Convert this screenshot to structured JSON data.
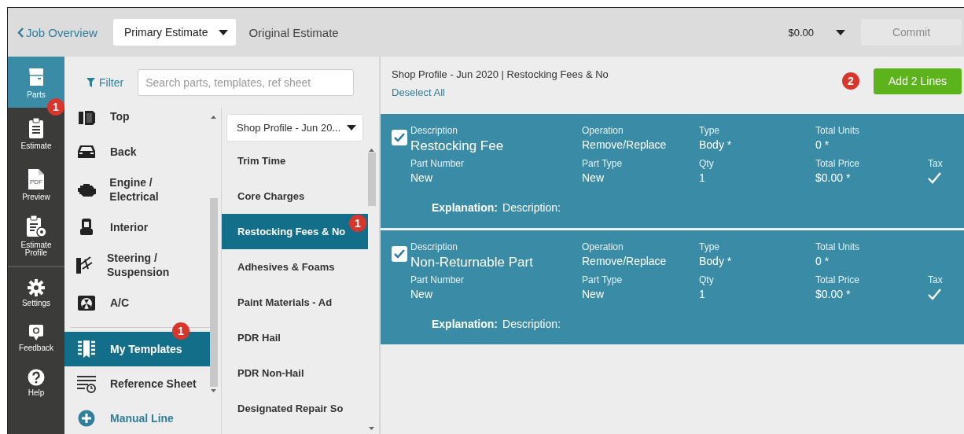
{
  "header": {
    "back_link": "Job Overview",
    "estimate_select": "Primary Estimate",
    "estimate_name": "Original Estimate",
    "total": "$0.00",
    "commit_button": {
      "label": "Commit",
      "disabled": true
    }
  },
  "rail": {
    "main": [
      {
        "label": "Parts",
        "kind": "door",
        "selected": true,
        "badge": "1"
      },
      {
        "label": "Estimate",
        "kind": "clipboard",
        "selected": false
      },
      {
        "label": "Preview",
        "kind": "pdf",
        "icon_text": "PDF",
        "selected": false
      },
      {
        "label": "Estimate Profile",
        "kind": "profile",
        "selected": false
      }
    ],
    "bottom": [
      {
        "label": "Settings",
        "kind": "gear",
        "selected": false
      },
      {
        "label": "Feedback",
        "kind": "chat",
        "selected": false
      },
      {
        "label": "Help",
        "kind": "help",
        "selected": false
      }
    ]
  },
  "browser": {
    "filter": "Filter",
    "search_placeholder": "Search parts, templates, ref sheet",
    "categories": [
      {
        "label": "Top",
        "kind": "top",
        "selected": false
      },
      {
        "label": "Back",
        "kind": "back",
        "selected": false
      },
      {
        "label": "Engine / Electrical",
        "kind": "engine",
        "selected": false
      },
      {
        "label": "Interior",
        "kind": "seat",
        "selected": false
      },
      {
        "label": "Steering / Suspension",
        "kind": "steering",
        "selected": false
      },
      {
        "label": "A/C",
        "kind": "fan",
        "selected": false
      }
    ],
    "library": [
      {
        "label": "My Templates",
        "kind": "templates",
        "selected": true,
        "badge": "1"
      },
      {
        "label": "Reference Sheet",
        "kind": "reference",
        "selected": false
      }
    ],
    "manual_line": "Manual Line",
    "profile_select": "Shop Profile - Jun 20...",
    "templates": [
      {
        "label": "Trim Time",
        "selected": false
      },
      {
        "label": "Core Charges",
        "selected": false
      },
      {
        "label": "Restocking Fees & No",
        "selected": true,
        "badge": "1"
      },
      {
        "label": "Adhesives & Foams",
        "selected": false
      },
      {
        "label": "Paint Materials - Ad",
        "selected": false
      },
      {
        "label": "PDR Hail",
        "selected": false
      },
      {
        "label": "PDR Non-Hail",
        "selected": false
      },
      {
        "label": "Designated Repair So",
        "selected": false
      }
    ]
  },
  "detail": {
    "breadcrumb": "Shop Profile - Jun 2020 | Restocking Fees & No",
    "deselect_all": "Deselect All",
    "step_badge": "2",
    "add_button": "Add 2 Lines",
    "lines": [
      {
        "checked": true,
        "fields": [
          {
            "label": "Description",
            "value": "Restocking Fee",
            "kind": "title"
          },
          {
            "label": "Operation",
            "value": "Remove/Replace"
          },
          {
            "label": "Type",
            "value": "Body *"
          },
          {
            "label": "Total Units",
            "value": "0 *"
          },
          {
            "label": "Part Number",
            "value": "New"
          },
          {
            "label": "Part Type",
            "value": "New"
          },
          {
            "label": "Qty",
            "value": "1"
          },
          {
            "label": "Total Price",
            "value": "$0.00 *"
          },
          {
            "label": "Tax",
            "kind": "check",
            "checked": true
          }
        ],
        "explanation_label": "Explanation:",
        "explanation": "Description:"
      },
      {
        "checked": true,
        "fields": [
          {
            "label": "Description",
            "value": "Non-Returnable Part",
            "kind": "title"
          },
          {
            "label": "Operation",
            "value": "Remove/Replace"
          },
          {
            "label": "Type",
            "value": "Body *"
          },
          {
            "label": "Total Units",
            "value": "0 *"
          },
          {
            "label": "Part Number",
            "value": "New"
          },
          {
            "label": "Part Type",
            "value": "New"
          },
          {
            "label": "Qty",
            "value": "1"
          },
          {
            "label": "Total Price",
            "value": "$0.00 *"
          },
          {
            "label": "Tax",
            "kind": "check",
            "checked": true
          }
        ],
        "explanation_label": "Explanation:",
        "explanation": "Description:"
      }
    ]
  }
}
